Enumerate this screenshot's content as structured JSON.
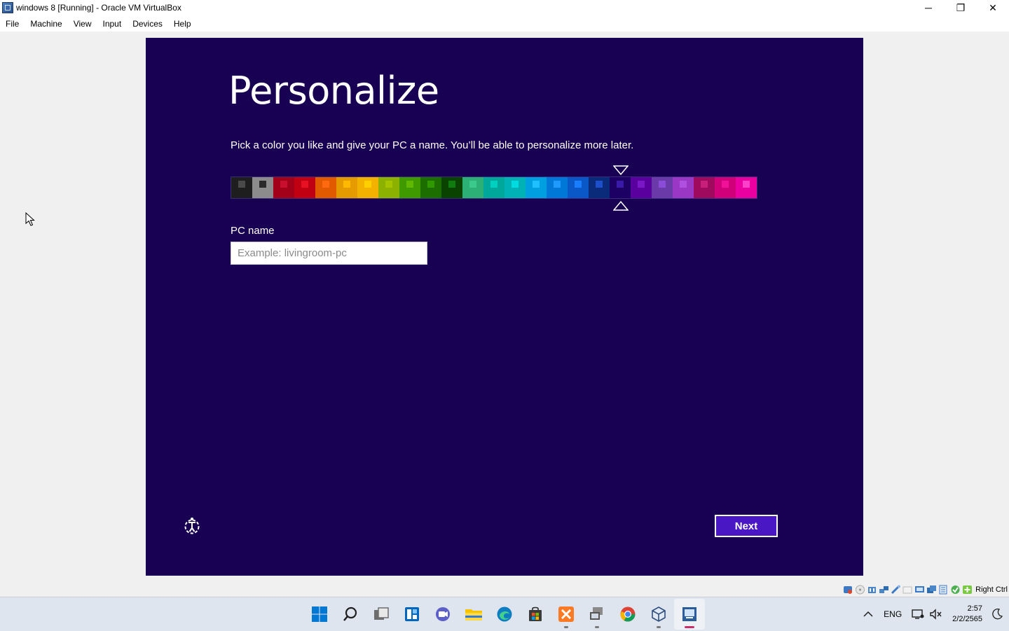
{
  "window": {
    "title": "windows 8 [Running] - Oracle VM VirtualBox",
    "controls": {
      "minimize": "─",
      "restore": "❐",
      "close": "✕"
    }
  },
  "menu": {
    "items": [
      {
        "label": "File"
      },
      {
        "label": "Machine"
      },
      {
        "label": "View"
      },
      {
        "label": "Input"
      },
      {
        "label": "Devices"
      },
      {
        "label": "Help"
      }
    ]
  },
  "guest": {
    "background": "#180052",
    "title": "Personalize",
    "description": "Pick a color you like and give your PC a name. You’ll be able to personalize more later.",
    "swatches": [
      {
        "bg": "#1e1e1e",
        "chip": "#4a4a4a"
      },
      {
        "bg": "#8c8c8c",
        "chip": "#2a2a2a"
      },
      {
        "bg": "#a3001a",
        "chip": "#c8102e"
      },
      {
        "bg": "#c00012",
        "chip": "#e81123"
      },
      {
        "bg": "#e25a00",
        "chip": "#ff6a10"
      },
      {
        "bg": "#e59b00",
        "chip": "#ffb900"
      },
      {
        "bg": "#f3b100",
        "chip": "#ffd000"
      },
      {
        "bg": "#8cb100",
        "chip": "#a4c400"
      },
      {
        "bg": "#3f9a00",
        "chip": "#60b800"
      },
      {
        "bg": "#1d6e00",
        "chip": "#2e9a00"
      },
      {
        "bg": "#0a4300",
        "chip": "#107c10"
      },
      {
        "bg": "#2db076",
        "chip": "#3cc98c"
      },
      {
        "bg": "#00a89b",
        "chip": "#00d0c0"
      },
      {
        "bg": "#00b1b6",
        "chip": "#00dbe0"
      },
      {
        "bg": "#009fe0",
        "chip": "#20c0ff"
      },
      {
        "bg": "#0078d7",
        "chip": "#1f9bff"
      },
      {
        "bg": "#0a58c8",
        "chip": "#1a7dff"
      },
      {
        "bg": "#0a2a7a",
        "chip": "#1d4fcb"
      },
      {
        "bg": "#1c0063",
        "chip": "#3a1aa8"
      },
      {
        "bg": "#5a009f",
        "chip": "#7a18c8"
      },
      {
        "bg": "#6a3aa8",
        "chip": "#8a4cd8"
      },
      {
        "bg": "#9a37c4",
        "chip": "#b050e0"
      },
      {
        "bg": "#a00a5e",
        "chip": "#c81f7a"
      },
      {
        "bg": "#d0007a",
        "chip": "#f0139a"
      },
      {
        "bg": "#ea00a0",
        "chip": "#ff40c8"
      }
    ],
    "selected_swatch": 18,
    "pc_name_label": "PC name",
    "pc_name_placeholder": "Example: livingroom-pc",
    "pc_name_value": "",
    "next_label": "Next",
    "ease_of_access_icon": "ease-of-access-icon"
  },
  "status_bar": {
    "icons": [
      "hard-disk-icon",
      "optical-drive-icon",
      "audio-icon",
      "network-icon",
      "usb-icon",
      "shared-folders-icon",
      "display-icon",
      "screen-capture-icon",
      "video-capture-icon",
      "cpu-icon",
      "mouse-integration-icon"
    ],
    "host_key": "Right Ctrl"
  },
  "taskbar": {
    "apps": [
      {
        "name": "start-icon",
        "color": "#0078d4"
      },
      {
        "name": "search-icon",
        "color": "#1f1f1f"
      },
      {
        "name": "task-view-icon",
        "color": "#3a3a3a"
      },
      {
        "name": "widgets-icon",
        "color": "#0067c0"
      },
      {
        "name": "chat-icon",
        "color": "#5b5fc7"
      },
      {
        "name": "file-explorer-icon",
        "color": "#f8c400"
      },
      {
        "name": "edge-icon",
        "color": "#0f7dc2"
      },
      {
        "name": "store-icon",
        "color": "#2b2b2b"
      },
      {
        "name": "xampp-icon",
        "color": "#fb7a24"
      },
      {
        "name": "remote-desktop-icon",
        "color": "#555555"
      },
      {
        "name": "chrome-icon",
        "color": "#db4437"
      },
      {
        "name": "virtualbox-icon",
        "color": "#2f4f7f"
      },
      {
        "name": "virtualbox-vm-icon",
        "color": "#2a5d9a"
      }
    ],
    "tray": {
      "language": "ENG",
      "time": "2:57",
      "date": "2/2/2565"
    }
  }
}
